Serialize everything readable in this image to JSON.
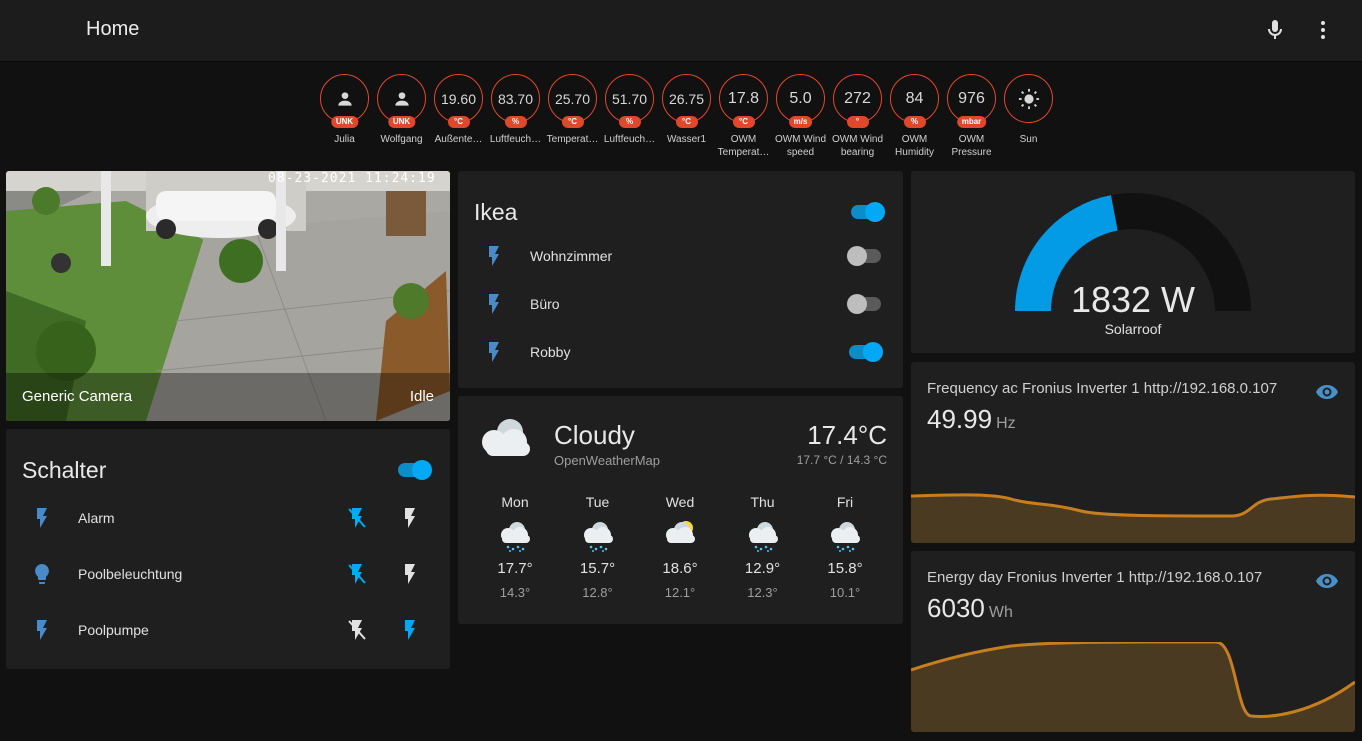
{
  "header": {
    "title": "Home"
  },
  "badges": [
    {
      "value": "",
      "unit": "UNK",
      "label": "Julia",
      "label2": "",
      "kind": "person"
    },
    {
      "value": "",
      "unit": "UNK",
      "label": "Wolfgang",
      "label2": "",
      "kind": "person"
    },
    {
      "value": "19.60",
      "unit": "°C",
      "label": "Außente…",
      "label2": ""
    },
    {
      "value": "83.70",
      "unit": "%",
      "label": "Luftfeuch…",
      "label2": ""
    },
    {
      "value": "25.70",
      "unit": "°C",
      "label": "Temperat…",
      "label2": ""
    },
    {
      "value": "51.70",
      "unit": "%",
      "label": "Luftfeuch…",
      "label2": ""
    },
    {
      "value": "26.75",
      "unit": "°C",
      "label": "Wasser1",
      "label2": ""
    },
    {
      "value": "17.8",
      "unit": "°C",
      "label": "OWM",
      "label2": "Temperat…"
    },
    {
      "value": "5.0",
      "unit": "m/s",
      "label": "OWM Wind",
      "label2": "speed"
    },
    {
      "value": "272",
      "unit": "°",
      "label": "OWM Wind",
      "label2": "bearing"
    },
    {
      "value": "84",
      "unit": "%",
      "label": "OWM",
      "label2": "Humidity"
    },
    {
      "value": "976",
      "unit": "mbar",
      "label": "OWM",
      "label2": "Pressure"
    },
    {
      "value": "",
      "unit": "",
      "label": "Sun",
      "label2": "",
      "kind": "sun"
    }
  ],
  "camera": {
    "name": "Generic Camera",
    "state": "Idle",
    "timestamp": "08-23-2021 11:24:19"
  },
  "schalter": {
    "title": "Schalter",
    "toggle_on": true,
    "rows": [
      {
        "name": "Alarm",
        "icon": "flash-icon",
        "off_active": true,
        "on_active": false
      },
      {
        "name": "Poolbeleuchtung",
        "icon": "bulb-icon",
        "off_active": true,
        "on_active": false
      },
      {
        "name": "Poolpumpe",
        "icon": "flash-icon",
        "off_active": false,
        "on_active": true
      }
    ]
  },
  "ikea": {
    "title": "Ikea",
    "toggle_on": true,
    "rows": [
      {
        "name": "Wohnzimmer",
        "on": false
      },
      {
        "name": "Büro",
        "on": false
      },
      {
        "name": "Robby",
        "on": true
      }
    ]
  },
  "weather": {
    "condition": "Cloudy",
    "source": "OpenWeatherMap",
    "temperature": "17.4°C",
    "range": "17.7 °C / 14.3 °C",
    "forecast": [
      {
        "day": "Mon",
        "hi": "17.7°",
        "lo": "14.3°",
        "icon": "rainy-icon"
      },
      {
        "day": "Tue",
        "hi": "15.7°",
        "lo": "12.8°",
        "icon": "rainy-icon"
      },
      {
        "day": "Wed",
        "hi": "18.6°",
        "lo": "12.1°",
        "icon": "partly-cloudy-icon"
      },
      {
        "day": "Thu",
        "hi": "12.9°",
        "lo": "12.3°",
        "icon": "rainy-icon"
      },
      {
        "day": "Fri",
        "hi": "15.8°",
        "lo": "10.1°",
        "icon": "rainy-icon"
      }
    ]
  },
  "gauge": {
    "value": "1832 W",
    "name": "Solarroof",
    "fraction": 0.44
  },
  "sensors": [
    {
      "name": "Frequency ac Fronius Inverter 1 http://192.168.0.107",
      "value": "49.99",
      "unit": "Hz"
    },
    {
      "name": "Energy day Fronius Inverter 1 http://192.168.0.107",
      "value": "6030",
      "unit": "Wh"
    }
  ],
  "colors": {
    "accent": "#03a9f4",
    "badge": "#e0482b",
    "graph": "#c77e1e",
    "gauge": "#039be5"
  }
}
